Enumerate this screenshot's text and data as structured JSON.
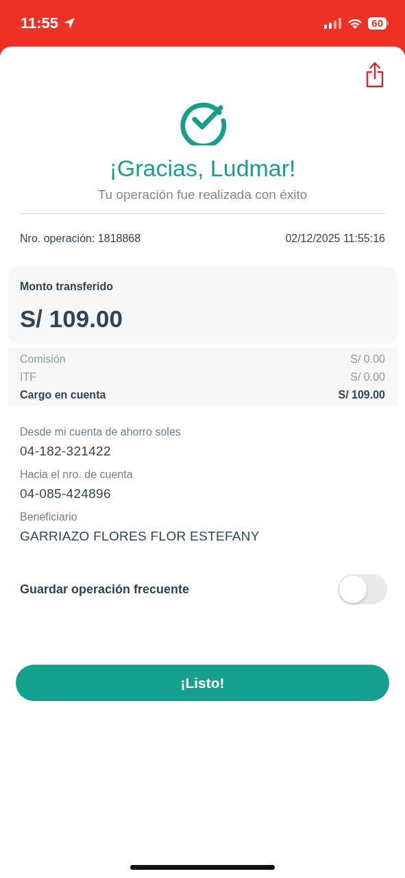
{
  "status_bar": {
    "time": "11:55",
    "battery": "60"
  },
  "header": {
    "title": "¡Gracias, Ludmar!",
    "subtitle": "Tu operación fue realizada con éxito"
  },
  "operation": {
    "number": "Nro. operación: 1818868",
    "datetime": "02/12/2025 11:55:16"
  },
  "amount_card": {
    "label": "Monto transferido",
    "amount": "S/ 109.00"
  },
  "charges": [
    {
      "kind": "fee",
      "label": "Comisión",
      "value": "S/ 0.00"
    },
    {
      "kind": "fee",
      "label": "ITF",
      "value": "S/ 0.00"
    },
    {
      "kind": "total",
      "label": "Cargo en cuenta",
      "value": "S/ 109.00"
    }
  ],
  "details": [
    {
      "label": "Desde mi cuenta de ahorro soles",
      "value": "04-182-321422"
    },
    {
      "label": "Hacia el nro. de cuenta",
      "value": "04-085-424896"
    },
    {
      "label": "Beneficiario",
      "value": "GARRIAZO FLORES FLOR ESTEFANY"
    }
  ],
  "save_frequent": {
    "label": "Guardar operación frecuente",
    "on": false
  },
  "button": "¡Listo!"
}
